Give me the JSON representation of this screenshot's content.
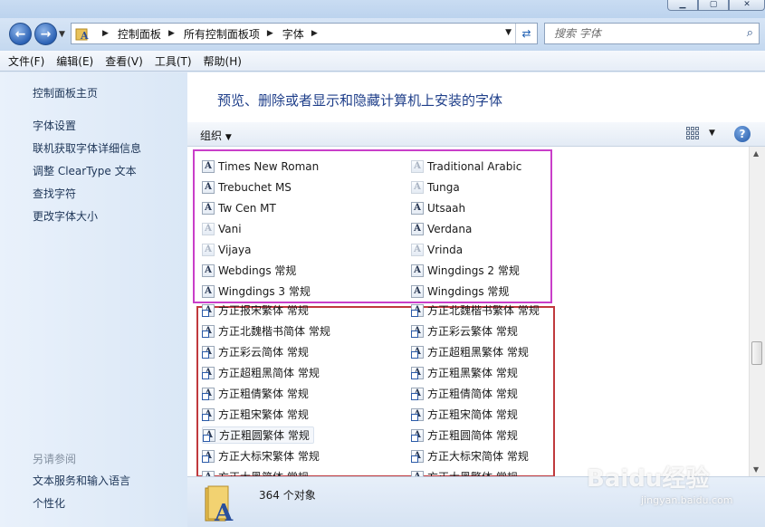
{
  "address": {
    "crumbs": [
      "控制面板",
      "所有控制面板项",
      "字体"
    ]
  },
  "search": {
    "placeholder": "搜索 字体"
  },
  "menu": [
    "文件(F)",
    "编辑(E)",
    "查看(V)",
    "工具(T)",
    "帮助(H)"
  ],
  "left_pane": {
    "home": "控制面板主页",
    "links": [
      "字体设置",
      "联机获取字体详细信息",
      "调整 ClearType 文本",
      "查找字符",
      "更改字体大小"
    ],
    "see_also_title": "另请参阅",
    "see_also": [
      "文本服务和输入语言",
      "个性化"
    ]
  },
  "header": {
    "title": "预览、删除或者显示和隐藏计算机上安装的字体"
  },
  "toolbar": {
    "organize": "组织"
  },
  "fonts_col1": [
    {
      "name": "Times New Roman",
      "icon": "font-a-icon"
    },
    {
      "name": "Trebuchet MS",
      "icon": "font-a-icon"
    },
    {
      "name": "Tw Cen MT",
      "icon": "font-a-icon"
    },
    {
      "name": "Vani",
      "icon": "font-a-light-icon"
    },
    {
      "name": "Vijaya",
      "icon": "font-a-light-icon"
    },
    {
      "name": "Webdings 常规",
      "icon": "font-a-icon"
    },
    {
      "name": "Wingdings 3 常规",
      "icon": "font-a-icon"
    },
    {
      "name": "方正报宋繁体 常规",
      "icon": "font-shortcut-icon"
    },
    {
      "name": "方正北魏楷书简体 常规",
      "icon": "font-shortcut-icon"
    },
    {
      "name": "方正彩云简体 常规",
      "icon": "font-shortcut-icon"
    },
    {
      "name": "方正超粗黑简体 常规",
      "icon": "font-shortcut-icon"
    },
    {
      "name": "方正粗倩繁体 常规",
      "icon": "font-shortcut-icon"
    },
    {
      "name": "方正粗宋繁体 常规",
      "icon": "font-shortcut-icon"
    },
    {
      "name": "方正粗圆繁体 常规",
      "icon": "font-shortcut-icon"
    },
    {
      "name": "方正大标宋繁体 常规",
      "icon": "font-shortcut-icon"
    },
    {
      "name": "方正大黑简体 常规",
      "icon": "font-shortcut-icon"
    }
  ],
  "fonts_col2": [
    {
      "name": "Traditional Arabic",
      "icon": "font-a-light-icon"
    },
    {
      "name": "Tunga",
      "icon": "font-a-light-icon"
    },
    {
      "name": "Utsaah",
      "icon": "font-a-icon"
    },
    {
      "name": "Verdana",
      "icon": "font-a-icon"
    },
    {
      "name": "Vrinda",
      "icon": "font-a-light-icon"
    },
    {
      "name": "Wingdings 2 常规",
      "icon": "font-a-icon"
    },
    {
      "name": "Wingdings 常规",
      "icon": "font-a-icon"
    },
    {
      "name": "方正北魏楷书繁体 常规",
      "icon": "font-shortcut-icon"
    },
    {
      "name": "方正彩云繁体 常规",
      "icon": "font-shortcut-icon"
    },
    {
      "name": "方正超粗黑繁体 常规",
      "icon": "font-shortcut-icon"
    },
    {
      "name": "方正粗黑繁体 常规",
      "icon": "font-shortcut-icon"
    },
    {
      "name": "方正粗倩简体 常规",
      "icon": "font-shortcut-icon"
    },
    {
      "name": "方正粗宋简体 常规",
      "icon": "font-shortcut-icon"
    },
    {
      "name": "方正粗圆简体 常规",
      "icon": "font-shortcut-icon"
    },
    {
      "name": "方正大标宋简体 常规",
      "icon": "font-shortcut-icon"
    },
    {
      "name": "方正大黑繁体 常规",
      "icon": "font-shortcut-icon"
    }
  ],
  "selected_item": "方正粗圆繁体 常规",
  "details": {
    "count": "364 个对象"
  },
  "watermark": {
    "brand": "Baidu经验",
    "url": "jingyan.baidu.com"
  },
  "colors": {
    "highlight_pink": "#c93ec9",
    "highlight_red": "#c0393d",
    "title_blue": "#1f3f8a"
  }
}
